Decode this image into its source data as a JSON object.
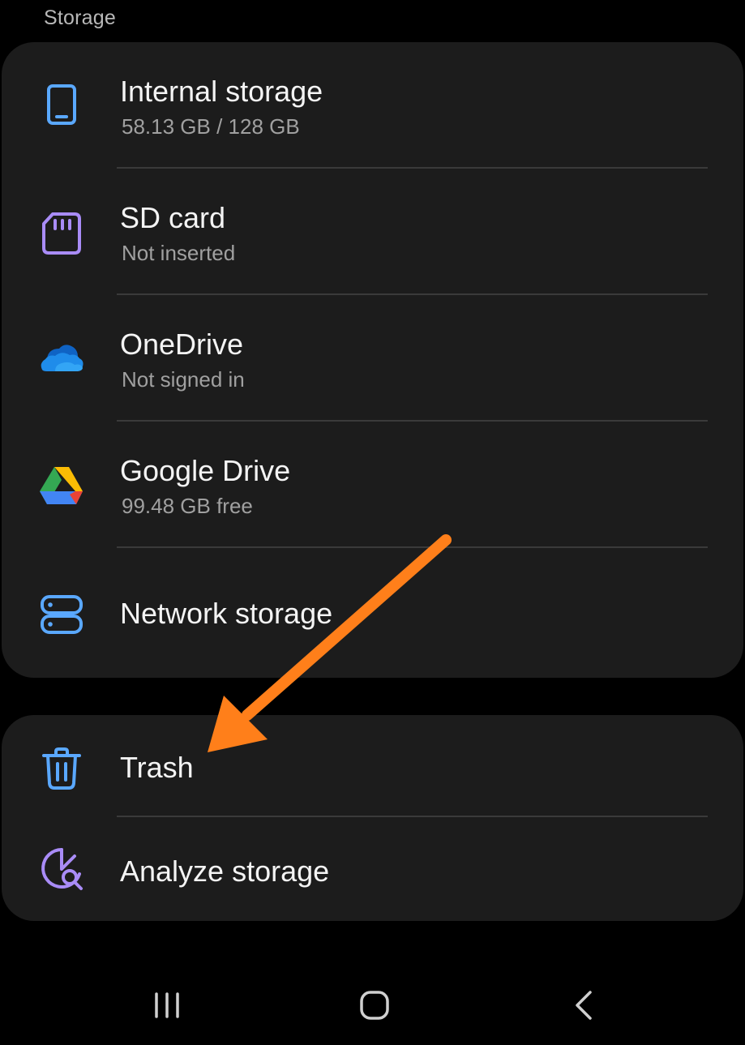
{
  "header": {
    "title": "Storage"
  },
  "storage_items": [
    {
      "title": "Internal storage",
      "subtitle": "58.13 GB / 128 GB",
      "icon": "phone-icon",
      "color": "#5aa8ff"
    },
    {
      "title": "SD card",
      "subtitle": "Not inserted",
      "icon": "sd-card-icon",
      "color": "#a98cf7"
    },
    {
      "title": "OneDrive",
      "subtitle": "Not signed in",
      "icon": "onedrive-icon",
      "color": "#1f8cea"
    },
    {
      "title": "Google Drive",
      "subtitle": "99.48 GB free",
      "icon": "google-drive-icon",
      "color": "#34a853"
    },
    {
      "title": "Network storage",
      "icon": "network-storage-icon",
      "color": "#5aa8ff"
    }
  ],
  "tool_items": [
    {
      "title": "Trash",
      "icon": "trash-icon",
      "color": "#5aa8ff"
    },
    {
      "title": "Analyze storage",
      "icon": "analyze-storage-icon",
      "color": "#a98cf7"
    }
  ],
  "annotation": {
    "arrow_color": "#ff7f1a",
    "arrow_target": "Trash"
  },
  "navbar": {
    "buttons": [
      "recent-apps-icon",
      "home-icon",
      "back-icon"
    ]
  },
  "colors": {
    "background": "#000000",
    "card": "#1c1c1c",
    "divider": "#3a3a3a",
    "title_text": "#f4f4f4",
    "subtitle_text": "#a0a0a0"
  }
}
